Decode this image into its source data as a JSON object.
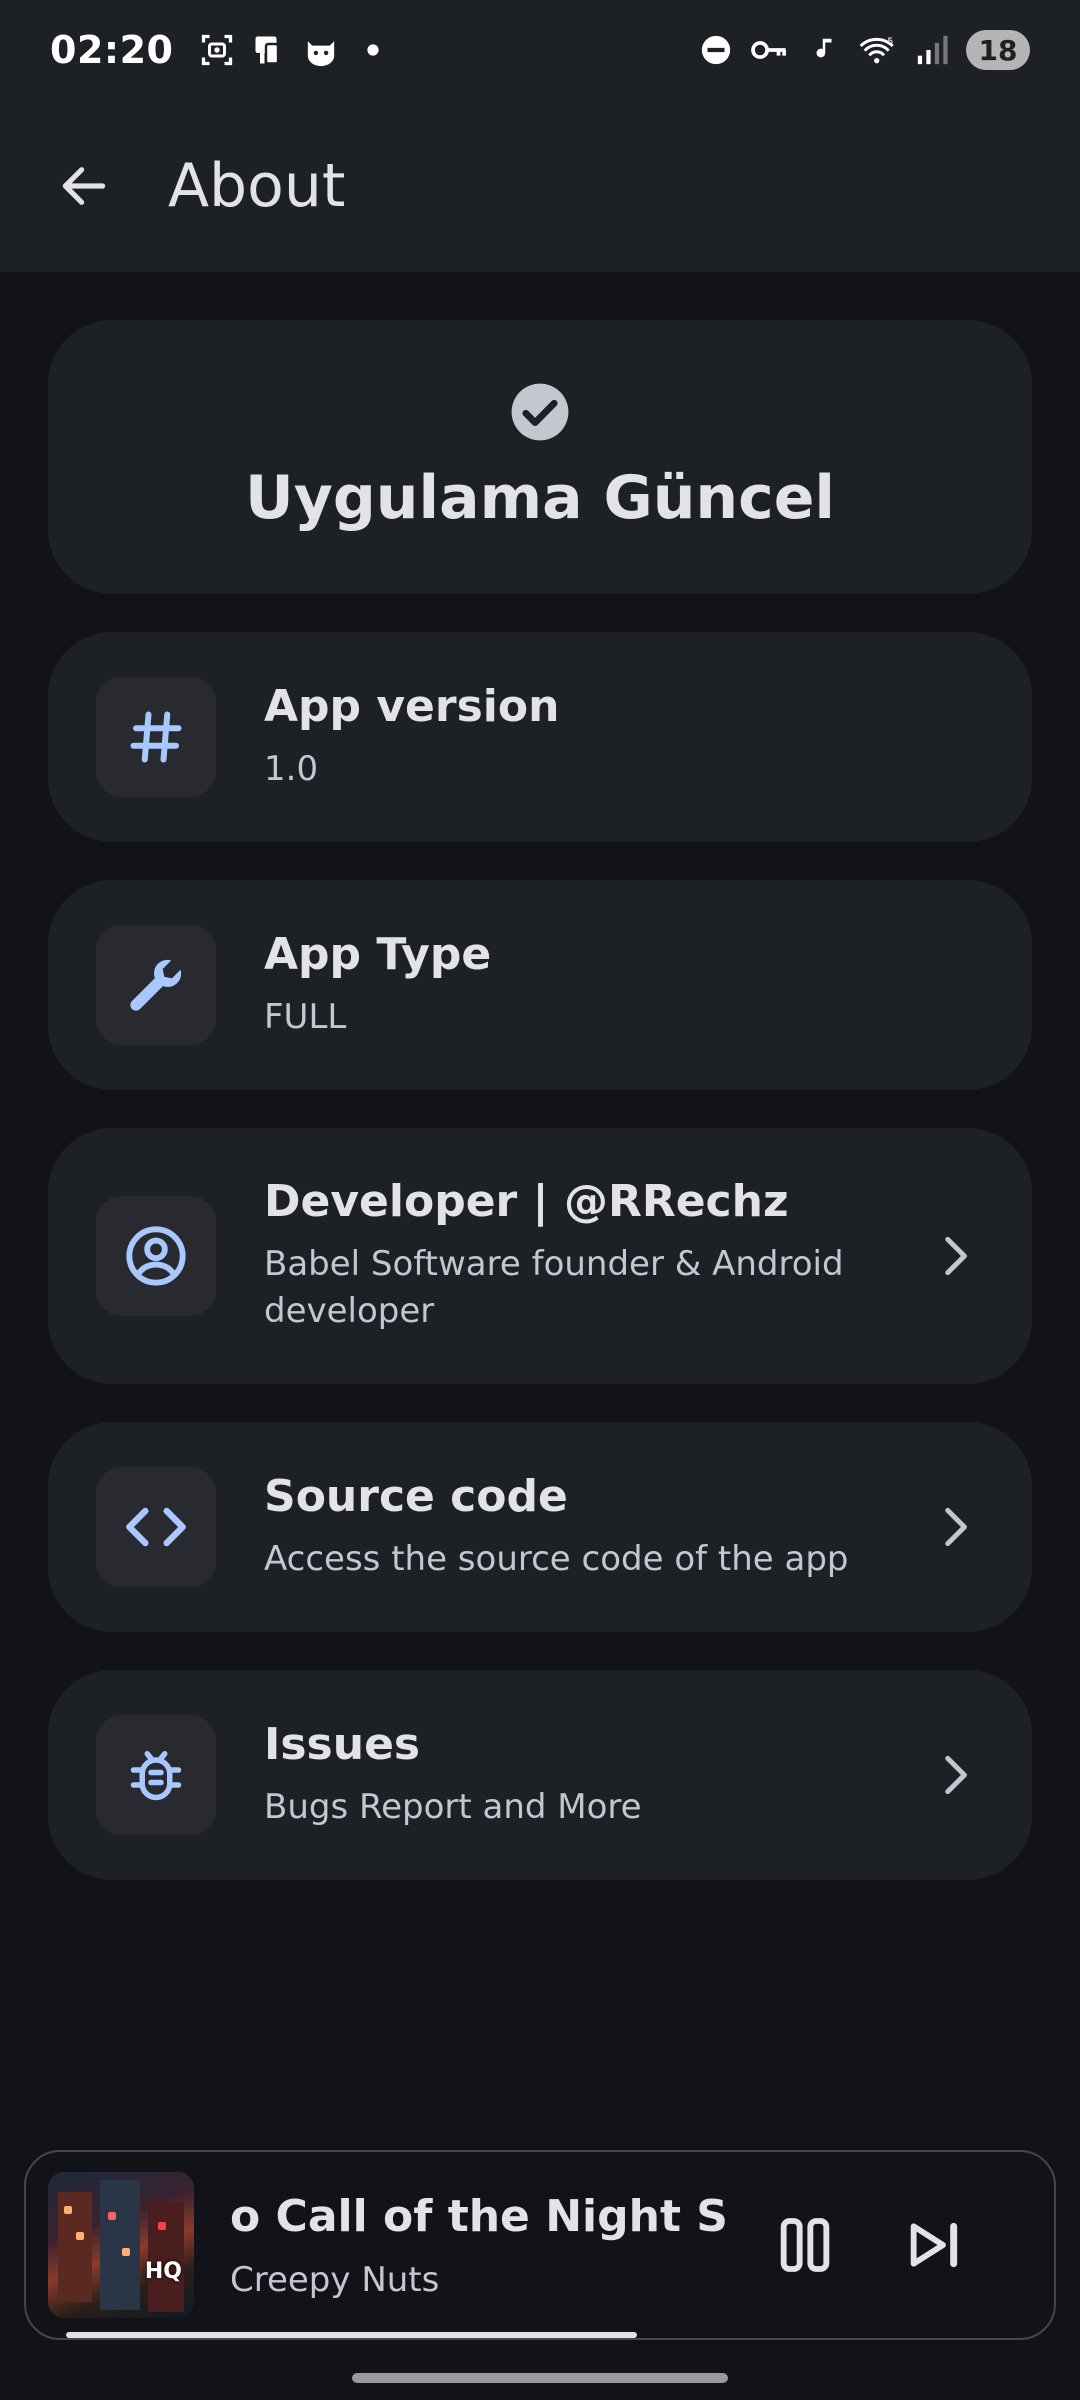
{
  "status_bar": {
    "time": "02:20",
    "battery": "18",
    "left_icons": [
      "screenshot-icon",
      "device-icon",
      "cat-app-icon",
      "dot-icon"
    ],
    "right_icons": [
      "dnd-icon",
      "vpn-key-icon",
      "music-note-icon",
      "wifi-icon",
      "signal-icon"
    ]
  },
  "app_bar": {
    "title": "About",
    "back_icon": "arrow-back-icon"
  },
  "header_card": {
    "icon": "check-circle-icon",
    "title": "Uygulama Güncel"
  },
  "items": [
    {
      "icon": "hash-icon",
      "title": "App version",
      "subtitle": "1.0",
      "has_chevron": false
    },
    {
      "icon": "wrench-icon",
      "title": "App Type",
      "subtitle": "FULL",
      "has_chevron": false
    },
    {
      "icon": "account-circle-icon",
      "title": "Developer | @RRechz",
      "subtitle": "Babel Software founder & Android developer",
      "has_chevron": true
    },
    {
      "icon": "code-icon",
      "title": "Source code",
      "subtitle": "Access the source code of the app",
      "has_chevron": true
    },
    {
      "icon": "bug-icon",
      "title": "Issues",
      "subtitle": "Bugs Report and More",
      "has_chevron": true
    }
  ],
  "player": {
    "title": "o Call of the Night Sea",
    "artist": "Creepy Nuts",
    "badge": "HQ",
    "progress": 0.6
  },
  "colors": {
    "background": "#111318",
    "surface": "#1d2024",
    "icon_accent": "#a8c8ff",
    "text_primary": "#e2e2e9",
    "text_secondary": "#c4c6d0"
  }
}
